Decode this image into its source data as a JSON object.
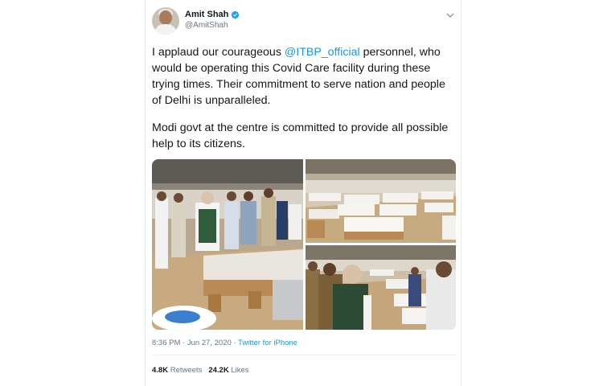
{
  "tweet": {
    "author": {
      "display_name": "Amit Shah",
      "handle": "@AmitShah",
      "verified_icon": "verified-badge-icon",
      "avatar_icon": "profile-avatar"
    },
    "text": {
      "para1_before": "I applaud our courageous ",
      "mention": "@ITBP_official",
      "para1_after": " personnel, who would be operating this Covid Care facility during these trying times. Their commitment to serve nation and people of Delhi is unparalleled.",
      "para2": "Modi govt at the centre is committed to provide all possible help to its citizens."
    },
    "timestamp": "8:36 PM · Jun 27, 2020",
    "separator": " · ",
    "source": "Twitter for iPhone",
    "stats": {
      "retweets_count": "4.8K",
      "retweets_label": "Retweets",
      "likes_count": "24.2K",
      "likes_label": "Likes"
    },
    "media": [
      {
        "description": "Officials walking through Covid care facility with cardboard beds",
        "icon": "photo-1"
      },
      {
        "description": "Rows of cardboard beds in large hall",
        "icon": "photo-2"
      },
      {
        "description": "Officials inspecting beds in facility",
        "icon": "photo-3"
      }
    ]
  },
  "colors": {
    "accent": "#1b95e0",
    "text": "#14171a",
    "secondary": "#657786",
    "border": "#e6ecf0"
  }
}
